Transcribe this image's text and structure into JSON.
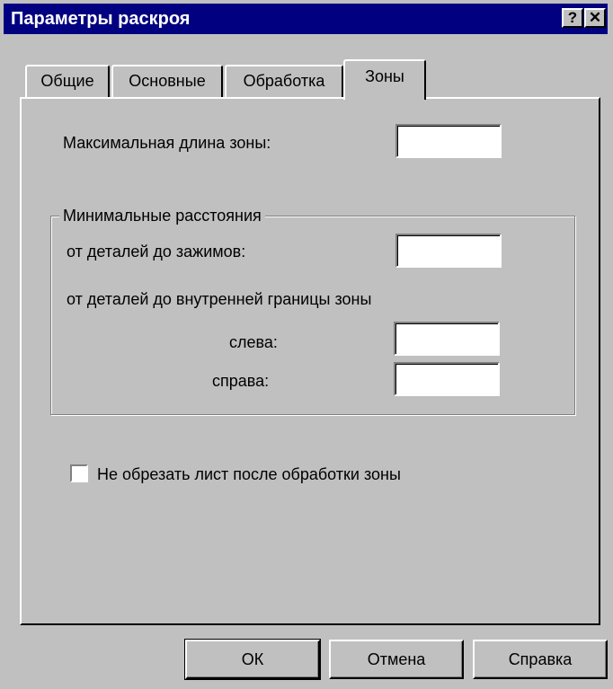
{
  "window": {
    "title": "Параметры раскроя",
    "help_glyph": "?",
    "close_glyph": "✕"
  },
  "tabs": [
    {
      "label": "Общие"
    },
    {
      "label": "Основные"
    },
    {
      "label": "Обработка"
    },
    {
      "label": "Зоны",
      "selected": true
    }
  ],
  "zones": {
    "max_length_label": "Максимальная длина зоны:",
    "max_length_value": "",
    "group_title": "Минимальные расстояния",
    "to_clamps_label": "от деталей до зажимов:",
    "to_clamps_value": "",
    "to_inner_boundary_label": "от деталей до внутренней границы зоны",
    "left_label": "слева:",
    "left_value": "",
    "right_label": "справа:",
    "right_value": "",
    "no_cut_checkbox_label": "Не обрезать лист после обработки зоны",
    "no_cut_checked": false
  },
  "buttons": {
    "ok": "ОК",
    "cancel": "Отмена",
    "help": "Справка"
  }
}
